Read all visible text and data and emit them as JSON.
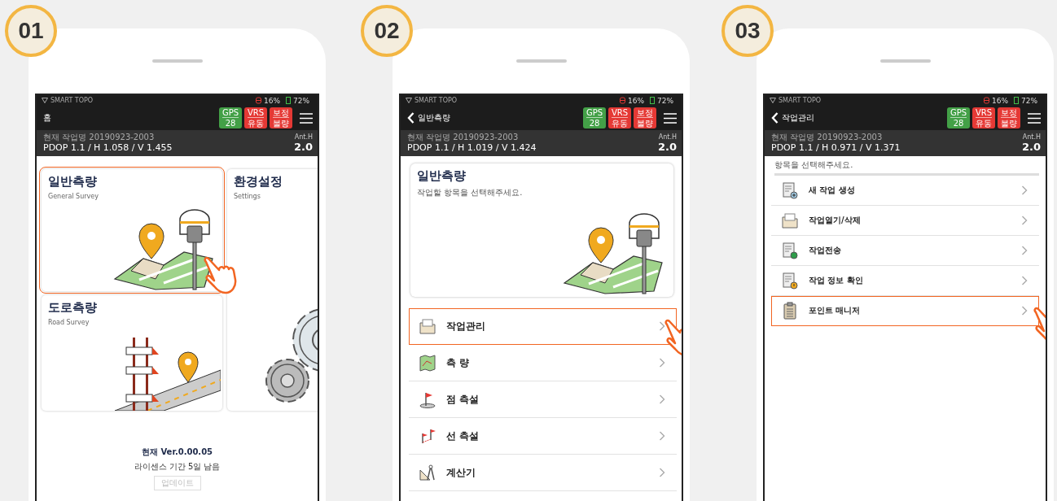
{
  "phones": [
    {
      "number": "01",
      "status": {
        "app": "SMART TOPO",
        "receiver": "16%",
        "battery": "72%"
      },
      "header": {
        "title": "홈",
        "back": false
      },
      "badges": [
        {
          "label": "GPS",
          "value": "28",
          "color": "#43a047"
        },
        {
          "label": "VRS",
          "value": "유동",
          "color": "#e53935"
        },
        {
          "label": "보정",
          "value": "불량",
          "color": "#e53935"
        }
      ],
      "info": {
        "job": "현재 작업명 20190923-2003",
        "precision": "PDOP 1.1 / H 1.058 / V 1.455",
        "ant_label": "Ant.H",
        "ant_value": "2.0"
      },
      "content": {
        "kind": "home",
        "tiles": [
          {
            "title": "일반측량",
            "subtitle": "General Survey",
            "kind": "survey",
            "selected": true
          },
          {
            "title": "환경설정",
            "subtitle": "Settings",
            "kind": "gears",
            "selected": false
          },
          {
            "title": "도로측량",
            "subtitle": "Road Survey",
            "kind": "road",
            "selected": false
          }
        ],
        "version": "현재 Ver.0.00.05",
        "license": "라이센스 기간 5일 남음",
        "update_button": "업데이트"
      }
    },
    {
      "number": "02",
      "status": {
        "app": "SMART TOPO",
        "receiver": "16%",
        "battery": "72%"
      },
      "header": {
        "title": "일반측량",
        "back": true
      },
      "badges": [
        {
          "label": "GPS",
          "value": "28",
          "color": "#43a047"
        },
        {
          "label": "VRS",
          "value": "유동",
          "color": "#e53935"
        },
        {
          "label": "보정",
          "value": "불량",
          "color": "#e53935"
        }
      ],
      "info": {
        "job": "현재 작업명 20190923-2003",
        "precision": "PDOP 1.1 / H 1.019 / V 1.424",
        "ant_label": "Ant.H",
        "ant_value": "2.0"
      },
      "content": {
        "kind": "menu",
        "card": {
          "title": "일반측량",
          "subtitle": "작업할 항목을 선택해주세요.",
          "kind": "survey"
        },
        "items": [
          {
            "label": "작업관리",
            "kind": "folder",
            "selected": true
          },
          {
            "label": "측 량",
            "kind": "map",
            "selected": false
          },
          {
            "label": "점 측설",
            "kind": "flag",
            "selected": false
          },
          {
            "label": "선 측설",
            "kind": "flags",
            "selected": false
          },
          {
            "label": "계산기",
            "kind": "ruler",
            "selected": false
          }
        ]
      }
    },
    {
      "number": "03",
      "status": {
        "app": "SMART TOPO",
        "receiver": "16%",
        "battery": "72%"
      },
      "header": {
        "title": "작업관리",
        "back": true
      },
      "badges": [
        {
          "label": "GPS",
          "value": "28",
          "color": "#43a047"
        },
        {
          "label": "VRS",
          "value": "유동",
          "color": "#e53935"
        },
        {
          "label": "보정",
          "value": "불량",
          "color": "#e53935"
        }
      ],
      "info": {
        "job": "현재 작업명 20190923-2003",
        "precision": "PDOP 1.1 / H 0.971 / V 1.371",
        "ant_label": "Ant.H",
        "ant_value": "2.0"
      },
      "content": {
        "kind": "list",
        "prompt": "항목을 선택해주세요.",
        "items": [
          {
            "label": "새 작업 생성",
            "kind": "docplus",
            "selected": false
          },
          {
            "label": "작업열기/삭제",
            "kind": "folder",
            "selected": false
          },
          {
            "label": "작업전송",
            "kind": "docsend",
            "selected": false
          },
          {
            "label": "작업 정보 확인",
            "kind": "docinfo",
            "selected": false
          },
          {
            "label": "포인트 매니저",
            "kind": "clipboard",
            "selected": true
          }
        ]
      }
    }
  ]
}
